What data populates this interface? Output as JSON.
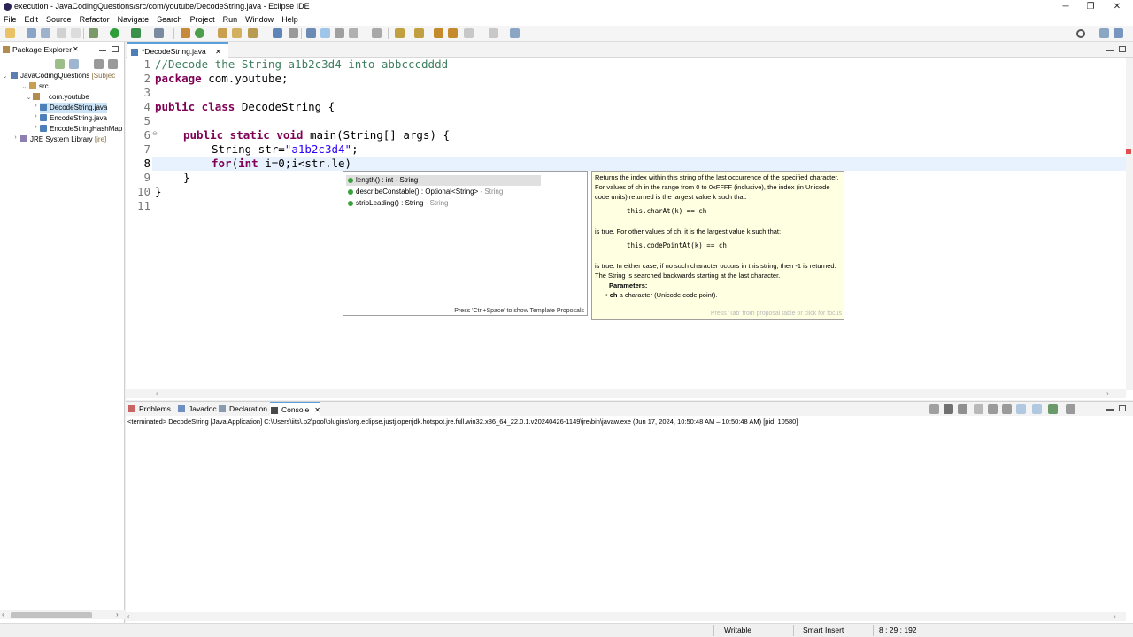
{
  "window": {
    "title": "execution - JavaCodingQuestions/src/com/youtube/DecodeString.java - Eclipse IDE",
    "minimize": "─",
    "maximize": "❐",
    "close": "✕"
  },
  "menu": [
    "File",
    "Edit",
    "Source",
    "Refactor",
    "Navigate",
    "Search",
    "Project",
    "Run",
    "Window",
    "Help"
  ],
  "package_explorer": {
    "tab_label": "Package Explorer",
    "tree": [
      {
        "label": "JavaCodingQuestions",
        "suffix": " [Subjec"
      },
      {
        "label": "src"
      },
      {
        "label": "com.youtube"
      },
      {
        "label": "DecodeString.java"
      },
      {
        "label": "EncodeString.java"
      },
      {
        "label": "EncodeStringHashMap"
      },
      {
        "label": "JRE System Library",
        "suffix": " [jre]"
      }
    ]
  },
  "editor": {
    "tab_label": "*DecodeString.java",
    "line_numbers": [
      "1",
      "2",
      "3",
      "4",
      "5",
      "6",
      "7",
      "8",
      "9",
      "10",
      "11"
    ],
    "lines": {
      "l1": "//Decode the String a1b2c3d4 into abbcccdddd",
      "l2_kw": "package",
      "l2_rest": " com.youtube;",
      "l4_kw": "public class",
      "l4_rest": " DecodeString {",
      "l6_kw": "public static void",
      "l6_rest": " main(String[] args) {",
      "l7_a": "String str=",
      "l7_str": "\"a1b2c3d4\"",
      "l7_b": ";",
      "l8_kw": "for",
      "l8_a": "(",
      "l8_kw2": "int",
      "l8_b": " i=0;i<str.le)",
      "l9": "}",
      "l10": "}"
    }
  },
  "completion": {
    "proposals": [
      {
        "name": "length() : int",
        "type": " - String"
      },
      {
        "name": "describeConstable() : Optional<String>",
        "type": " - String"
      },
      {
        "name": "stripLeading() : String",
        "type": " - String"
      }
    ],
    "footer": "Press 'Ctrl+Space' to show Template Proposals"
  },
  "javadoc": {
    "p1": "Returns the index within this string of the last occurrence of the specified character. For values of ch in the range from 0 to 0xFFFF (inclusive), the index (in Unicode code units) returned is the largest value k such that:",
    "code1": "this.charAt(k) == ch",
    "p2": "is true. For other values of ch, it is the largest value k such that:",
    "code2": "this.codePointAt(k) == ch",
    "p3": "is true. In either case, if no such character occurs in this string, then -1 is returned. The String is searched backwards starting at the last character.",
    "params_label": "Parameters:",
    "param_name": "ch",
    "param_desc": " a character (Unicode code point).",
    "footer": "Press 'Tab' from proposal table or click for focus"
  },
  "bottom_tabs": [
    "Problems",
    "Javadoc",
    "Declaration",
    "Console"
  ],
  "console": {
    "line": "<terminated> DecodeString [Java Application] C:\\Users\\iits\\.p2\\pool\\plugins\\org.eclipse.justj.openjdk.hotspot.jre.full.win32.x86_64_22.0.1.v20240426-1149\\jre\\bin\\javaw.exe  (Jun 17, 2024, 10:50:48 AM – 10:50:48 AM) [pid: 10580]"
  },
  "status": {
    "writable": "Writable",
    "insert_mode": "Smart Insert",
    "position": "8 : 29 : 192"
  },
  "colors": {
    "keyword": "#7f0055",
    "comment": "#3f7f5f",
    "string": "#2a00ff",
    "javadoc_bg": "#ffffe1",
    "selection": "#cce4f7"
  }
}
